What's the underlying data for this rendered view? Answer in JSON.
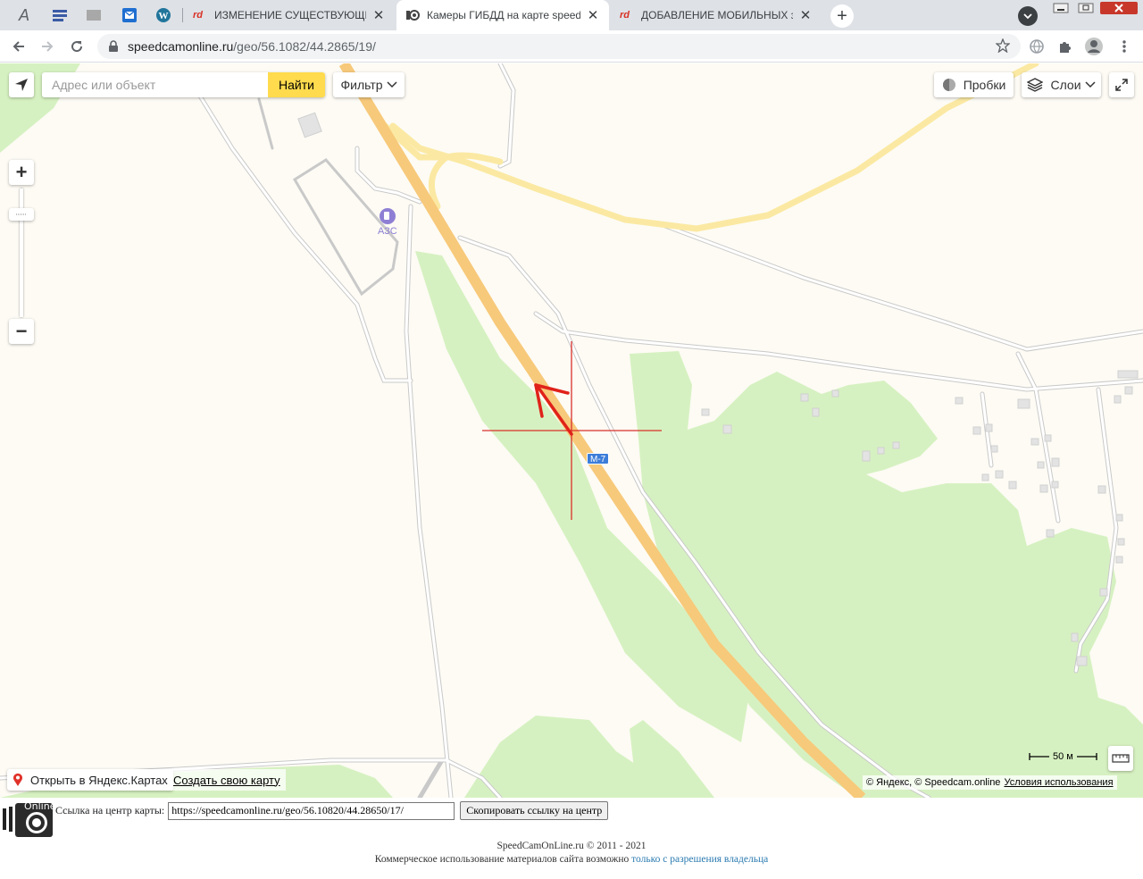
{
  "browser": {
    "tabs": [
      {
        "title": "ИЗМЕНЕНИЕ СУЩЕСТВУЮЩИХ",
        "icon": "rd-logo-icon",
        "active": false
      },
      {
        "title": "Камеры ГИБДД на карте speedcam",
        "icon": "speedcam-favicon-icon",
        "active": true
      },
      {
        "title": "ДОБАВЛЕНИЕ МОБИЛЬНЫХ зас",
        "icon": "rd-logo-icon",
        "active": false
      }
    ],
    "tab_close": "✕",
    "new_tab": "+",
    "url_host": "speedcamonline.ru",
    "url_path": "/geo/56.1082/44.2865/19/"
  },
  "map": {
    "search_placeholder": "Адрес или объект",
    "search_button": "Найти",
    "filter_label": "Фильтр",
    "traffic_label": "Пробки",
    "layers_label": "Слои",
    "zoom_in": "+",
    "zoom_out": "−",
    "road_badge": "М-7",
    "poi_label": "АЗС",
    "open_yandex": "Открыть в Яндекс.Картах",
    "create_map": "Создать свою карту",
    "scale_label": "50 м",
    "copyright": "© Яндекс, © Speedcam.online",
    "terms": "Условия использования",
    "colors": {
      "highway": "#f7c97a",
      "forest": "#d6f1c1",
      "road": "#ffffff",
      "marker": "#e0221a"
    }
  },
  "page": {
    "link_label": "Ссылка на центр карты:",
    "link_value": "https://speedcamonline.ru/geo/56.10820/44.28650/17/",
    "copy_button": "Скопировать ссылку на центр",
    "footer_line1": "SpeedCamOnLine.ru © 2011 - 2021",
    "footer_line2": "Коммерческое использование материалов сайта возможно",
    "footer_link": "только с разрешения владельца",
    "logo_text": "Online"
  }
}
